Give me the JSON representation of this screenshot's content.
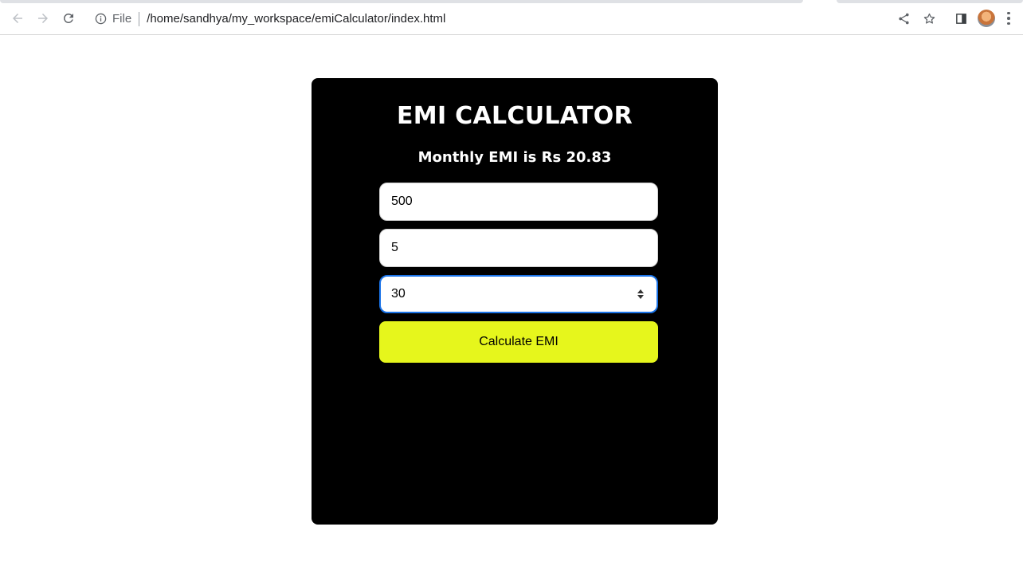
{
  "browser": {
    "scheme_label": "File",
    "url": "/home/sandhya/my_workspace/emiCalculator/index.html",
    "icons": {
      "back": "back-arrow-icon",
      "forward": "forward-arrow-icon",
      "reload": "reload-icon",
      "info": "info-icon",
      "share": "share-icon",
      "bookmark": "star-icon",
      "side_panel": "side-panel-icon",
      "profile": "avatar",
      "menu": "kebab-menu-icon"
    }
  },
  "calculator": {
    "title": "EMI CALCULATOR",
    "result_text": "Monthly EMI is Rs 20.83",
    "principal_value": "500",
    "rate_value": "5",
    "tenure_value": "30",
    "button_label": "Calculate EMI",
    "colors": {
      "card_background": "#000000",
      "button_background": "#e6f61c",
      "focus_border": "#1a73e8"
    }
  }
}
